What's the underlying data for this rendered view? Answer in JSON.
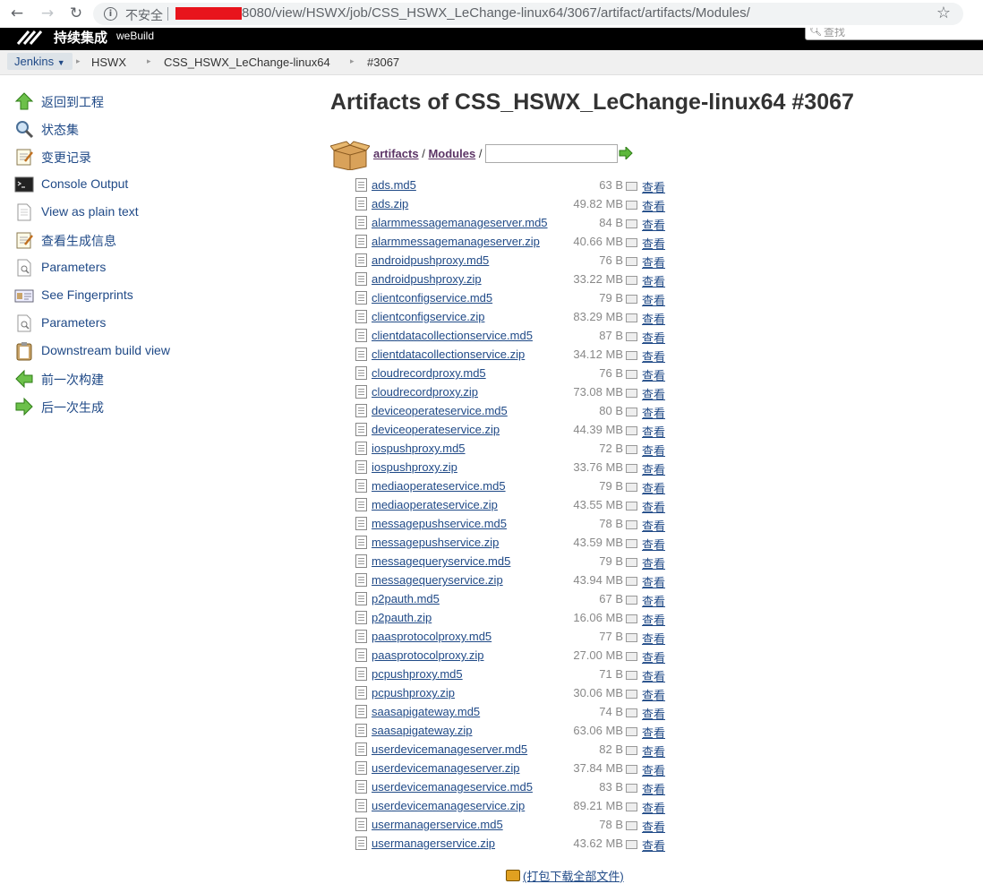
{
  "browser": {
    "insecure_label": "不安全",
    "url": "8080/view/HSWX/job/CSS_HSWX_LeChange-linux64/3067/artifact/artifacts/Modules/"
  },
  "header": {
    "logo_text": "持续集成",
    "logo_sub": "weBuild",
    "search_placeholder": "查找"
  },
  "breadcrumb": {
    "items": [
      "Jenkins",
      "HSWX",
      "CSS_HSWX_LeChange-linux64",
      "#3067"
    ]
  },
  "side_tasks": [
    {
      "label": "返回到工程",
      "icon": "up-arrow-icon"
    },
    {
      "label": "状态集",
      "icon": "magnifier-icon"
    },
    {
      "label": "变更记录",
      "icon": "notepad-icon"
    },
    {
      "label": "Console Output",
      "icon": "terminal-icon"
    },
    {
      "label": "View as plain text",
      "icon": "document-icon"
    },
    {
      "label": "查看生成信息",
      "icon": "notepad-icon"
    },
    {
      "label": "Parameters",
      "icon": "document-search-icon"
    },
    {
      "label": "See Fingerprints",
      "icon": "fingerprint-card-icon"
    },
    {
      "label": "Parameters",
      "icon": "document-search-icon"
    },
    {
      "label": "Downstream build view",
      "icon": "clipboard-icon"
    },
    {
      "label": "前一次构建",
      "icon": "left-arrow-icon"
    },
    {
      "label": "后一次生成",
      "icon": "right-arrow-icon"
    }
  ],
  "main": {
    "title": "Artifacts of CSS_HSWX_LeChange-linux64 #3067",
    "path_root": "artifacts",
    "path_sep": "/",
    "path_dir": "Modules",
    "view_label": "查看",
    "download_all": "(打包下载全部文件)"
  },
  "files": [
    {
      "name": "ads.md5",
      "size": "63 B"
    },
    {
      "name": "ads.zip",
      "size": "49.82 MB"
    },
    {
      "name": "alarmmessagemanageserver.md5",
      "size": "84 B"
    },
    {
      "name": "alarmmessagemanageserver.zip",
      "size": "40.66 MB"
    },
    {
      "name": "androidpushproxy.md5",
      "size": "76 B"
    },
    {
      "name": "androidpushproxy.zip",
      "size": "33.22 MB"
    },
    {
      "name": "clientconfigservice.md5",
      "size": "79 B"
    },
    {
      "name": "clientconfigservice.zip",
      "size": "83.29 MB"
    },
    {
      "name": "clientdatacollectionservice.md5",
      "size": "87 B"
    },
    {
      "name": "clientdatacollectionservice.zip",
      "size": "34.12 MB"
    },
    {
      "name": "cloudrecordproxy.md5",
      "size": "76 B"
    },
    {
      "name": "cloudrecordproxy.zip",
      "size": "73.08 MB"
    },
    {
      "name": "deviceoperateservice.md5",
      "size": "80 B"
    },
    {
      "name": "deviceoperateservice.zip",
      "size": "44.39 MB"
    },
    {
      "name": "iospushproxy.md5",
      "size": "72 B"
    },
    {
      "name": "iospushproxy.zip",
      "size": "33.76 MB"
    },
    {
      "name": "mediaoperateservice.md5",
      "size": "79 B"
    },
    {
      "name": "mediaoperateservice.zip",
      "size": "43.55 MB"
    },
    {
      "name": "messagepushservice.md5",
      "size": "78 B"
    },
    {
      "name": "messagepushservice.zip",
      "size": "43.59 MB"
    },
    {
      "name": "messagequeryservice.md5",
      "size": "79 B"
    },
    {
      "name": "messagequeryservice.zip",
      "size": "43.94 MB"
    },
    {
      "name": "p2pauth.md5",
      "size": "67 B"
    },
    {
      "name": "p2pauth.zip",
      "size": "16.06 MB"
    },
    {
      "name": "paasprotocolproxy.md5",
      "size": "77 B"
    },
    {
      "name": "paasprotocolproxy.zip",
      "size": "27.00 MB"
    },
    {
      "name": "pcpushproxy.md5",
      "size": "71 B"
    },
    {
      "name": "pcpushproxy.zip",
      "size": "30.06 MB"
    },
    {
      "name": "saasapigateway.md5",
      "size": "74 B"
    },
    {
      "name": "saasapigateway.zip",
      "size": "63.06 MB"
    },
    {
      "name": "userdevicemanageserver.md5",
      "size": "82 B"
    },
    {
      "name": "userdevicemanageserver.zip",
      "size": "37.84 MB"
    },
    {
      "name": "userdevicemanageservice.md5",
      "size": "83 B"
    },
    {
      "name": "userdevicemanageservice.zip",
      "size": "89.21 MB"
    },
    {
      "name": "usermanagerservice.md5",
      "size": "78 B"
    },
    {
      "name": "usermanagerservice.zip",
      "size": "43.62 MB"
    }
  ]
}
